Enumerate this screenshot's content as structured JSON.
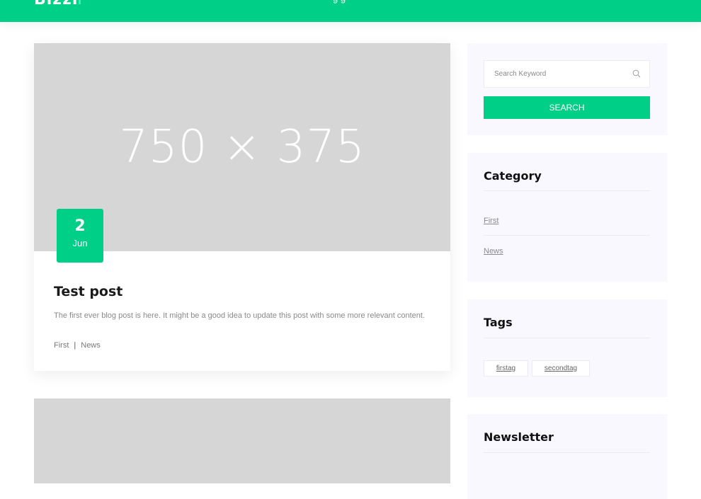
{
  "header": {
    "logo": "Bizzi",
    "nav_text": "g    g"
  },
  "post": {
    "image_placeholder": "750 × 375",
    "date_day": "2",
    "date_month": "Jun",
    "title": "Test post",
    "excerpt": "The first ever blog post is here. It might be a good idea to update this post with some more relevant content.",
    "categories": [
      "First",
      "News"
    ],
    "separator": "|"
  },
  "sidebar": {
    "search": {
      "placeholder": "Search Keyword",
      "button_label": "SEARCH"
    },
    "category": {
      "title": "Category",
      "items": [
        "First",
        "News"
      ]
    },
    "tags": {
      "title": "Tags",
      "items": [
        "firstag",
        "secondtag"
      ]
    },
    "newsletter": {
      "title": "Newsletter"
    }
  },
  "colors": {
    "brand": "#00cf87",
    "widget_bg": "#f9f7ff",
    "placeholder_bg": "#d6d6d6"
  }
}
